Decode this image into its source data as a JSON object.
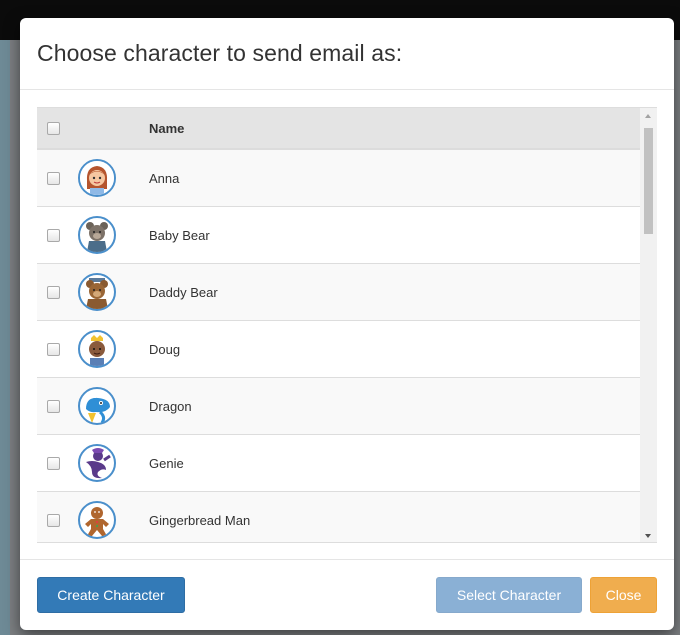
{
  "modal": {
    "title": "Choose character to send email as:"
  },
  "table": {
    "header": {
      "name": "Name"
    },
    "rows": [
      {
        "name": "Anna",
        "avatar": "girl-avatar-icon"
      },
      {
        "name": "Baby Bear",
        "avatar": "bear-avatar-icon"
      },
      {
        "name": "Daddy Bear",
        "avatar": "bear-avatar-icon"
      },
      {
        "name": "Doug",
        "avatar": "boy-avatar-icon"
      },
      {
        "name": "Dragon",
        "avatar": "dragon-avatar-icon"
      },
      {
        "name": "Genie",
        "avatar": "genie-avatar-icon"
      },
      {
        "name": "Gingerbread Man",
        "avatar": "gingerbread-avatar-icon"
      }
    ]
  },
  "footer": {
    "create_label": "Create Character",
    "select_label": "Select Character",
    "close_label": "Close"
  },
  "colors": {
    "primary": "#337ab7",
    "primary_disabled": "#8ab0d5",
    "warning": "#f0ad4e",
    "avatar_ring": "#4a8fcb"
  }
}
